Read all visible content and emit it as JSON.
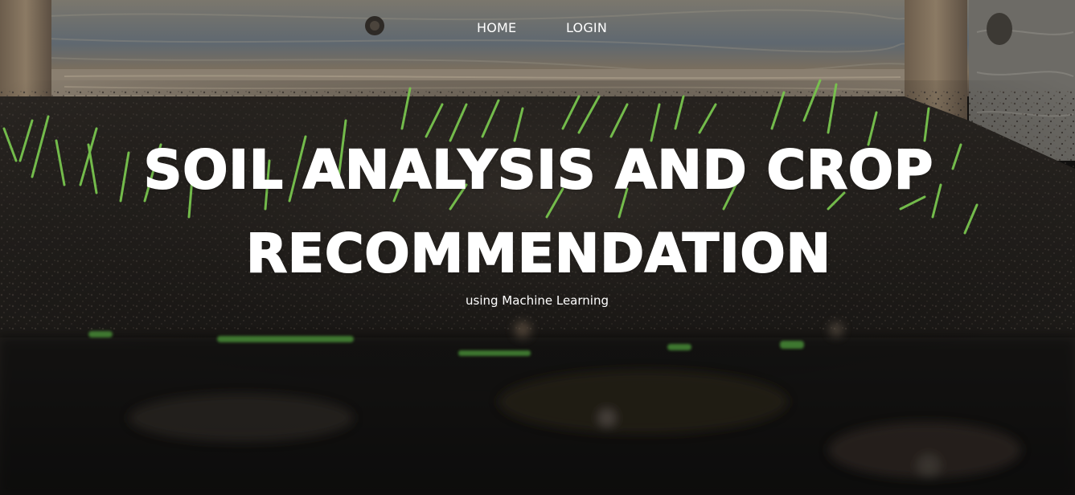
{
  "nav": {
    "home_label": "HOME",
    "login_label": "LOGIN"
  },
  "hero": {
    "title_line1": "SOIL ANALYSIS AND CROP",
    "title_line2": "RECOMMENDATION",
    "subtitle": "using Machine Learning"
  },
  "colors": {
    "text": "#ffffff",
    "soil_dark": "#121110",
    "wood": "#6f6a60",
    "sprout_green": "#6fbf4a"
  },
  "icons": {
    "background": "soil-sprouts-photo"
  }
}
